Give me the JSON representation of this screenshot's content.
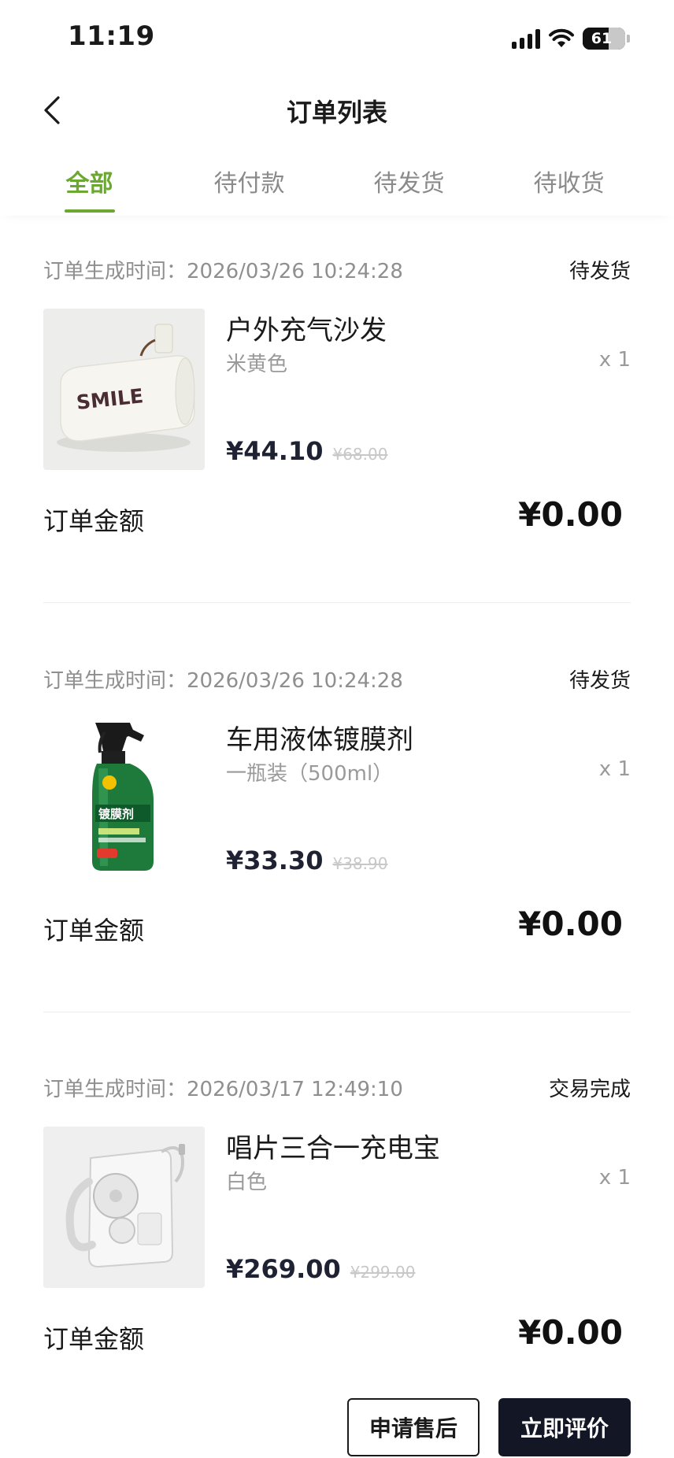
{
  "status_bar": {
    "time": "11:19",
    "battery": "61"
  },
  "nav": {
    "title": "订单列表"
  },
  "tabs": [
    {
      "label": "全部",
      "active": true
    },
    {
      "label": "待付款",
      "active": false
    },
    {
      "label": "待发货",
      "active": false
    },
    {
      "label": "待收货",
      "active": false
    }
  ],
  "orders": [
    {
      "time": "订单生成时间：2026/03/26 10:24:28",
      "status": "待发货",
      "product": {
        "name": "户外充气沙发",
        "spec": "米黄色",
        "qty": "x 1",
        "price": "¥44.10",
        "original_price": "¥68.00",
        "image_icon": "inflatable-sofa"
      },
      "total_label": "订单金额",
      "total_value": "¥0.00"
    },
    {
      "time": "订单生成时间：2026/03/26 10:24:28",
      "status": "待发货",
      "product": {
        "name": "车用液体镀膜剂",
        "spec": "一瓶装（500ml）",
        "qty": "x 1",
        "price": "¥33.30",
        "original_price": "¥38.90",
        "image_icon": "spray-bottle"
      },
      "total_label": "订单金额",
      "total_value": "¥0.00"
    },
    {
      "time": "订单生成时间：2026/03/17 12:49:10",
      "status": "交易完成",
      "product": {
        "name": "唱片三合一充电宝",
        "spec": "白色",
        "qty": "x 1",
        "price": "¥269.00",
        "original_price": "¥299.00",
        "image_icon": "power-bank"
      },
      "total_label": "订单金额",
      "total_value": "¥0.00",
      "actions": {
        "after_sales": "申请售后",
        "review": "立即评价"
      }
    }
  ],
  "colors": {
    "accent": "#6aa832",
    "dark_button": "#121625"
  }
}
